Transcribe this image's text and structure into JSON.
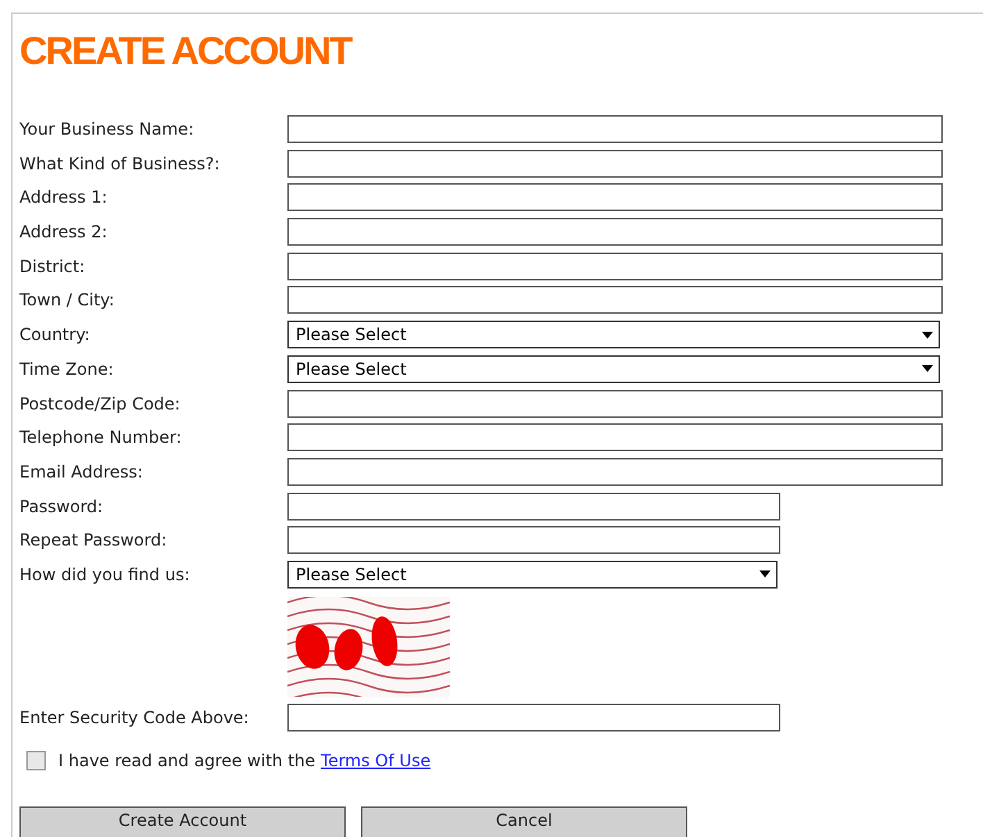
{
  "title": "CREATE ACCOUNT",
  "details": [
    {
      "label": "Your Business Name:",
      "kind": "text"
    },
    {
      "label": "What Kind of Business?:",
      "kind": "text"
    },
    {
      "label": "Address 1:",
      "kind": "text"
    },
    {
      "label": "Address 2:",
      "kind": "text"
    },
    {
      "label": "District:",
      "kind": "text"
    },
    {
      "label": "Town / City:",
      "kind": "text"
    },
    {
      "label": "Country:",
      "kind": "select",
      "value": "Please Select"
    },
    {
      "label": "Time Zone:",
      "kind": "select",
      "value": "Please Select"
    },
    {
      "label": "Postcode/Zip Code:",
      "kind": "text"
    },
    {
      "label": "Telephone Number:",
      "kind": "text"
    },
    {
      "label": "Email Address:",
      "kind": "text"
    }
  ],
  "account": [
    {
      "label": "Password:",
      "kind": "text"
    },
    {
      "label": "Repeat Password:",
      "kind": "text"
    },
    {
      "label": "How did you find us:",
      "kind": "select",
      "value": "Please Select"
    }
  ],
  "captcha": {
    "kind": "picture"
  },
  "security_code": {
    "label": "Enter Security Code Above:"
  },
  "terms": {
    "checked": false,
    "text": "I have read and agree with the",
    "link": "Terms Of Use"
  },
  "buttons": [
    "Create Account",
    "Cancel"
  ]
}
